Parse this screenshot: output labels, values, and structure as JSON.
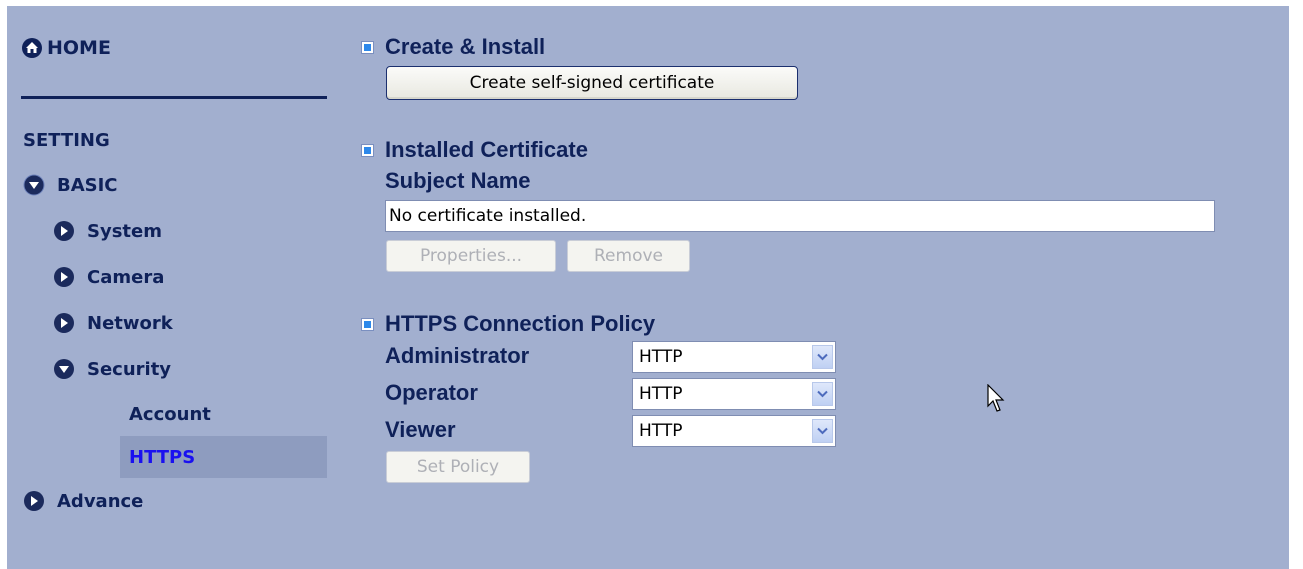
{
  "sidebar": {
    "home_label": "HOME",
    "setting_label": "SETTING",
    "basic_label": "BASIC",
    "system_label": "System",
    "camera_label": "Camera",
    "network_label": "Network",
    "security_label": "Security",
    "account_label": "Account",
    "https_label": "HTTPS",
    "advance_label": "Advance"
  },
  "main": {
    "create_install_title": "Create & Install",
    "create_button_label": "Create self-signed certificate",
    "installed_title": "Installed Certificate",
    "subject_name_label": "Subject Name",
    "subject_name_value": "No certificate installed.",
    "properties_button_label": "Properties...",
    "remove_button_label": "Remove",
    "policy_title": "HTTPS Connection Policy",
    "administrator_label": "Administrator",
    "administrator_value": "HTTP",
    "operator_label": "Operator",
    "operator_value": "HTTP",
    "viewer_label": "Viewer",
    "viewer_value": "HTTP",
    "set_policy_label": "Set Policy"
  },
  "colors": {
    "background": "#a2afcf",
    "text": "#0f2159",
    "active_link": "#1a10f0",
    "active_row": "#8e9cbf",
    "bullet": "#2d88ea"
  },
  "icons": {
    "home": "house-icon",
    "expanded": "arrow-down-circle-icon",
    "collapsed": "arrow-right-circle-icon",
    "bullet": "square-bullet-icon",
    "select_arrow": "chevron-down-icon",
    "cursor": "mouse-pointer-icon"
  }
}
